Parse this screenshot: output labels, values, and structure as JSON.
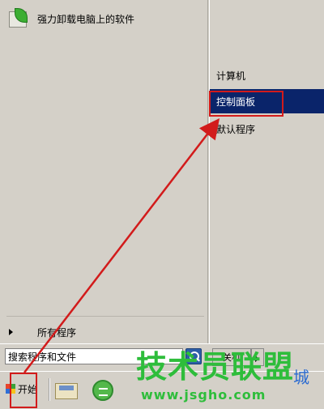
{
  "left_pane": {
    "pinned_program": "强力卸载电脑上的软件",
    "all_programs": "所有程序"
  },
  "right_pane": {
    "items": [
      {
        "label": "计算机"
      },
      {
        "label": "控制面板"
      },
      {
        "label": "默认程序"
      }
    ]
  },
  "bottom_bar": {
    "search_placeholder": "搜索程序和文件",
    "shutdown_label": "关机"
  },
  "taskbar": {
    "start_label": "开始"
  },
  "watermark": {
    "title": "技术员联盟",
    "suffix": "城",
    "url": "www.jsgho.com"
  },
  "annotations": {
    "highlight_color": "#d21b1b",
    "selection_color": "#0a246a"
  }
}
